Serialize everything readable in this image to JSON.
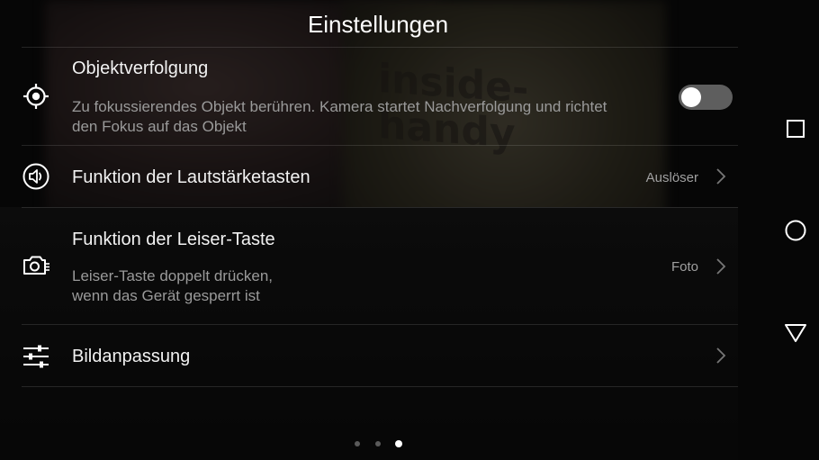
{
  "header": {
    "title": "Einstellungen"
  },
  "background": {
    "watermark_text": "inside-handy"
  },
  "settings": {
    "tracking": {
      "label": "Objektverfolgung",
      "description_line1": "Zu fokussierendes Objekt berühren. Kamera startet Nachverfolgung und richtet",
      "description_line2": "den Fokus auf das Objekt",
      "icon": "target-icon",
      "toggle_on": false
    },
    "volume_keys": {
      "label": "Funktion der Lautstärketasten",
      "value": "Auslöser",
      "icon": "speaker-icon"
    },
    "volume_down": {
      "label": "Funktion der Leiser-Taste",
      "description_line1": "Leiser-Taste doppelt drücken,",
      "description_line2": "wenn das Gerät gesperrt ist",
      "value": "Foto",
      "icon": "camera-icon"
    },
    "image_adjust": {
      "label": "Bildanpassung",
      "icon": "sliders-icon"
    }
  },
  "pager": {
    "count": 3,
    "active_index": 2
  },
  "navbar": {
    "buttons": [
      "recents-square-icon",
      "home-circle-icon",
      "back-triangle-icon"
    ]
  },
  "colors": {
    "background": "#0c0c0c",
    "text": "#ffffff",
    "secondary_text": "#9a9a9a",
    "toggle_off": "#5e5e5e"
  }
}
